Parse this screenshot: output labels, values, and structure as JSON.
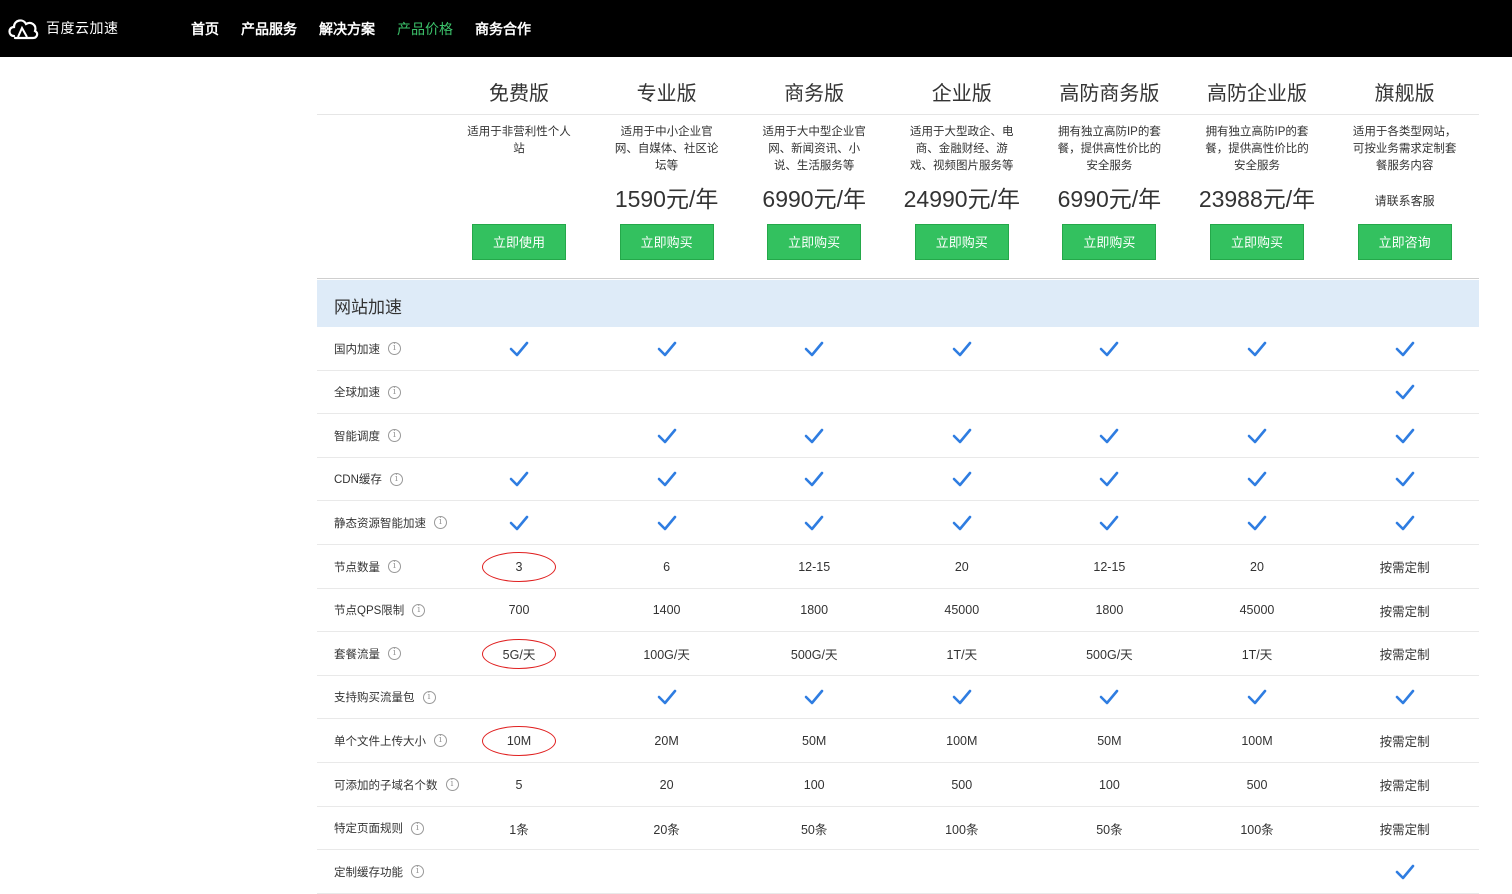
{
  "topbar": {
    "logo_text": "百度云加速",
    "nav": [
      {
        "label": "首页",
        "active": false
      },
      {
        "label": "产品服务",
        "active": false
      },
      {
        "label": "解决方案",
        "active": false
      },
      {
        "label": "产品价格",
        "active": true
      },
      {
        "label": "商务合作",
        "active": false
      }
    ]
  },
  "plans": [
    {
      "name": "免费版",
      "desc": "适用于非营利性个人站",
      "price": "",
      "contact": "",
      "button": "立即使用"
    },
    {
      "name": "专业版",
      "desc": "适用于中小企业官网、自媒体、社区论坛等",
      "price": "1590元/年",
      "contact": "",
      "button": "立即购买"
    },
    {
      "name": "商务版",
      "desc": "适用于大中型企业官网、新闻资讯、小说、生活服务等",
      "price": "6990元/年",
      "contact": "",
      "button": "立即购买"
    },
    {
      "name": "企业版",
      "desc": "适用于大型政企、电商、金融财经、游戏、视频图片服务等",
      "price": "24990元/年",
      "contact": "",
      "button": "立即购买"
    },
    {
      "name": "高防商务版",
      "desc": "拥有独立高防IP的套餐，提供高性价比的安全服务",
      "price": "6990元/年",
      "contact": "",
      "button": "立即购买"
    },
    {
      "name": "高防企业版",
      "desc": "拥有独立高防IP的套餐，提供高性价比的安全服务",
      "price": "23988元/年",
      "contact": "",
      "button": "立即购买"
    },
    {
      "name": "旗舰版",
      "desc": "适用于各类型网站，可按业务需求定制套餐服务内容",
      "price": "",
      "contact": "请联系客服",
      "button": "立即咨询"
    }
  ],
  "section": {
    "title": "网站加速"
  },
  "info_glyph": "i",
  "rows": [
    {
      "label": "国内加速",
      "values": [
        "✓",
        "✓",
        "✓",
        "✓",
        "✓",
        "✓",
        "✓"
      ]
    },
    {
      "label": "全球加速",
      "values": [
        "",
        "",
        "",
        "",
        "",
        "",
        "✓"
      ]
    },
    {
      "label": "智能调度",
      "values": [
        "",
        "✓",
        "✓",
        "✓",
        "✓",
        "✓",
        "✓"
      ]
    },
    {
      "label": "CDN缓存",
      "values": [
        "✓",
        "✓",
        "✓",
        "✓",
        "✓",
        "✓",
        "✓"
      ]
    },
    {
      "label": "静态资源智能加速",
      "values": [
        "✓",
        "✓",
        "✓",
        "✓",
        "✓",
        "✓",
        "✓"
      ]
    },
    {
      "label": "节点数量",
      "values": [
        "3",
        "6",
        "12-15",
        "20",
        "12-15",
        "20",
        "按需定制"
      ]
    },
    {
      "label": "节点QPS限制",
      "values": [
        "700",
        "1400",
        "1800",
        "45000",
        "1800",
        "45000",
        "按需定制"
      ]
    },
    {
      "label": "套餐流量",
      "values": [
        "5G/天",
        "100G/天",
        "500G/天",
        "1T/天",
        "500G/天",
        "1T/天",
        "按需定制"
      ]
    },
    {
      "label": "支持购买流量包",
      "values": [
        "",
        "✓",
        "✓",
        "✓",
        "✓",
        "✓",
        "✓"
      ]
    },
    {
      "label": "单个文件上传大小",
      "values": [
        "10M",
        "20M",
        "50M",
        "100M",
        "50M",
        "100M",
        "按需定制"
      ]
    },
    {
      "label": "可添加的子域名个数",
      "values": [
        "5",
        "20",
        "100",
        "500",
        "100",
        "500",
        "按需定制"
      ]
    },
    {
      "label": "特定页面规则",
      "values": [
        "1条",
        "20条",
        "50条",
        "100条",
        "50条",
        "100条",
        "按需定制"
      ]
    },
    {
      "label": "定制缓存功能",
      "values": [
        "",
        "",
        "",
        "",
        "",
        "",
        "✓"
      ]
    }
  ],
  "highlighted_cells": [
    {
      "row": "节点数量",
      "plan": "免费版"
    },
    {
      "row": "套餐流量",
      "plan": "免费版"
    },
    {
      "row": "单个文件上传大小",
      "plan": "免费版"
    }
  ],
  "colors": {
    "accent_green": "#33c15f",
    "check_blue": "#2f7de1",
    "section_bg": "#deebf8",
    "highlight_red": "#e02020"
  }
}
